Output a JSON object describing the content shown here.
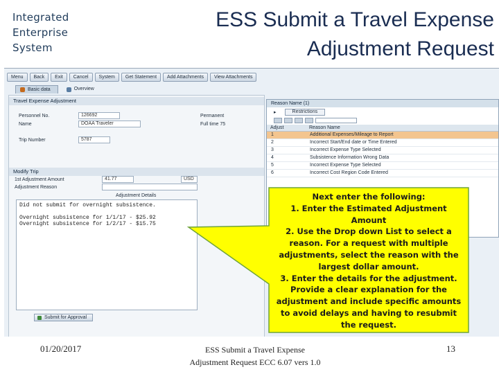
{
  "brand": {
    "line1": "Integrated",
    "line2": "Enterprise",
    "line3": "System"
  },
  "slide_title": {
    "line1": "ESS Submit a Travel Expense",
    "line2": "Adjustment Request"
  },
  "screenshot": {
    "toolbar": [
      "Menu",
      "Back",
      "Exit",
      "Cancel",
      "System",
      "Get Statement",
      "Add Attachments",
      "View Attachments"
    ],
    "tabs": [
      {
        "label": "Basic data",
        "icon": "basic-data-icon"
      },
      {
        "label": "Overview",
        "icon": "overview-icon"
      }
    ],
    "travel_section": {
      "title": "Travel Expense Adjustment",
      "personnel_label": "Personnel No.",
      "personnel_value": "126692",
      "permanent_label": "Permanent",
      "name_label": "Name",
      "name_value": "DOAA Traveler",
      "fulltime_label": "Full time 75",
      "trip_label": "Trip Number",
      "trip_value": "5787"
    },
    "modify_section": {
      "title": "Modify Trip",
      "amount_label": "1st Adjustment Amount",
      "amount_value": "41.77",
      "currency": "USD",
      "reason_label": "Adjustment Reason",
      "details_label": "Adjustment Details",
      "details_text": "Did not submit for overnight subsistence.\n\nOvernight subsistence for 1/1/17 - $25.92\nOvernight subsistence for 1/2/17 - $15.75"
    },
    "submit_button": "Submit for Approval",
    "reason_panel": {
      "title": "Reason Name (1)",
      "restrictions": "Restrictions",
      "columns": [
        "Adjust",
        "Reason Name"
      ],
      "rows": [
        {
          "num": "1",
          "reason": "Additional Expenses/Mileage to Report",
          "selected": true
        },
        {
          "num": "2",
          "reason": "Incorrect Start/End date or Time Entered",
          "selected": false
        },
        {
          "num": "3",
          "reason": "Incorrect Expense Type Selected",
          "selected": false
        },
        {
          "num": "4",
          "reason": "Subsistence Information Wrong Data",
          "selected": false
        },
        {
          "num": "5",
          "reason": "Incorrect Expense Type Selected",
          "selected": false
        },
        {
          "num": "6",
          "reason": "Incorrect Cost Region Code Entered",
          "selected": false
        }
      ]
    }
  },
  "callout": {
    "lines": [
      "Next enter the following:",
      "1.  Enter the Estimated Adjustment",
      "Amount",
      "2.  Use the Drop down List to select a",
      "reason.  For a request with multiple",
      "adjustments, select the reason with the",
      "largest dollar amount.",
      "3.  Enter the details for the adjustment.",
      "Provide a clear explanation for the",
      "adjustment and include specific amounts",
      "to avoid delays and having to resubmit",
      "the request."
    ],
    "fill_color": "#ffff00",
    "border_color": "#6fa33a"
  },
  "footer": {
    "date": "01/20/2017",
    "center_line1": "ESS Submit a Travel Expense",
    "center_line2": "Adjustment Request ECC 6.07 vers 1.0",
    "page": "13"
  }
}
